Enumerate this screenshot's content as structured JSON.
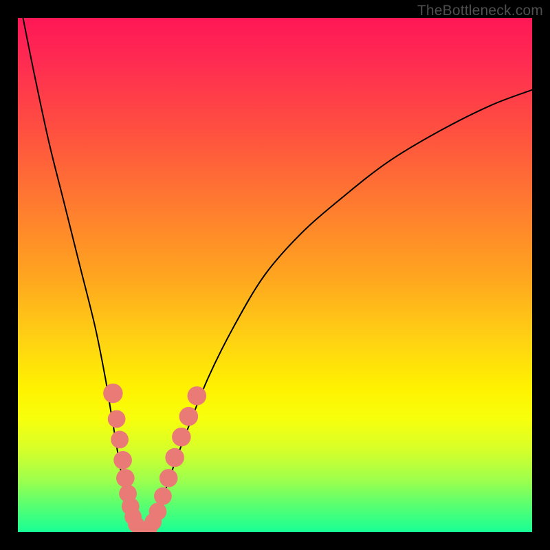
{
  "watermark": "TheBottleneck.com",
  "chart_data": {
    "type": "line",
    "title": "",
    "xlabel": "",
    "ylabel": "",
    "xlim": [
      0,
      100
    ],
    "ylim": [
      0,
      100
    ],
    "grid": false,
    "legend": false,
    "background_gradient": {
      "top": "#ff1756",
      "mid": "#fff200",
      "bottom": "#18ff95"
    },
    "series": [
      {
        "name": "bottleneck-curve",
        "color": "#000000",
        "x": [
          1,
          3,
          6,
          9,
          12,
          15,
          17,
          18,
          19,
          20,
          21,
          22,
          23,
          24,
          25,
          26,
          27,
          28,
          30,
          33,
          37,
          42,
          48,
          55,
          63,
          72,
          82,
          92,
          100
        ],
        "y": [
          100,
          90,
          76,
          64,
          52,
          40,
          30,
          24,
          18,
          12,
          7,
          3,
          1,
          0,
          0,
          1,
          3,
          6,
          12,
          20,
          30,
          40,
          50,
          58,
          65,
          72,
          78,
          83,
          86
        ]
      }
    ],
    "markers": {
      "name": "highlight-points",
      "color": "#e97a76",
      "points": [
        {
          "x": 18.5,
          "y": 27,
          "r": 2.5
        },
        {
          "x": 19.2,
          "y": 22,
          "r": 2.2
        },
        {
          "x": 19.8,
          "y": 18,
          "r": 2.2
        },
        {
          "x": 20.4,
          "y": 14,
          "r": 2.3
        },
        {
          "x": 20.9,
          "y": 10.5,
          "r": 2.3
        },
        {
          "x": 21.4,
          "y": 7.5,
          "r": 2.2
        },
        {
          "x": 21.9,
          "y": 5,
          "r": 2.2
        },
        {
          "x": 22.4,
          "y": 3,
          "r": 2.1
        },
        {
          "x": 23.0,
          "y": 1.5,
          "r": 2.0
        },
        {
          "x": 23.8,
          "y": 0.5,
          "r": 2.0
        },
        {
          "x": 24.6,
          "y": 0.3,
          "r": 2.0
        },
        {
          "x": 25.5,
          "y": 0.8,
          "r": 2.1
        },
        {
          "x": 26.3,
          "y": 2,
          "r": 2.1
        },
        {
          "x": 27.2,
          "y": 4,
          "r": 2.2
        },
        {
          "x": 28.2,
          "y": 7,
          "r": 2.2
        },
        {
          "x": 29.3,
          "y": 10.5,
          "r": 2.3
        },
        {
          "x": 30.5,
          "y": 14.5,
          "r": 2.4
        },
        {
          "x": 31.8,
          "y": 18.5,
          "r": 2.4
        },
        {
          "x": 33.2,
          "y": 22.5,
          "r": 2.4
        },
        {
          "x": 34.8,
          "y": 26.5,
          "r": 2.4
        }
      ]
    }
  }
}
